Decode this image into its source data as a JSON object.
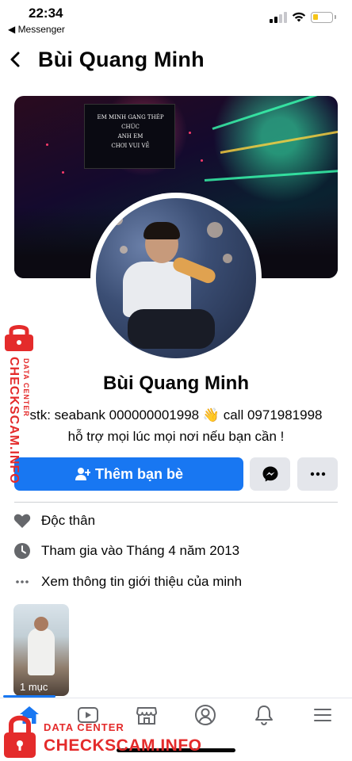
{
  "status_bar": {
    "time": "22:34",
    "back_app": "◀ Messenger",
    "battery_percent": 30,
    "battery_color": "#f5c518"
  },
  "header": {
    "title": "Bùi Quang Minh",
    "back_icon": "chevron-left-icon"
  },
  "cover": {
    "screen_text": "EM MINH GANG THÉP\nCHÚC\nANH EM\nCHƠI VUI VẺ"
  },
  "profile": {
    "name": "Bùi Quang Minh",
    "bio_line1": "stk: seabank 000000001998 👋 call 0971981998",
    "bio_line2": "hỗ trợ mọi lúc mọi nơi nếu bạn cần !"
  },
  "actions": {
    "add_friend_label": "Thêm bạn bè",
    "add_friend_icon": "person-add-icon",
    "message_icon": "messenger-icon",
    "more_icon": "more-icon",
    "accent": "#1877f2"
  },
  "info": {
    "relationship": "Độc thân",
    "joined": "Tham gia vào Tháng 4 năm 2013",
    "see_about": "Xem thông tin giới thiệu của minh"
  },
  "photos": {
    "caption": "1 mục"
  },
  "bottom_nav": [
    {
      "name": "home",
      "icon": "home-icon",
      "active": true
    },
    {
      "name": "video",
      "icon": "video-icon",
      "active": false
    },
    {
      "name": "marketplace",
      "icon": "marketplace-icon",
      "active": false
    },
    {
      "name": "profile",
      "icon": "profile-icon",
      "active": false
    },
    {
      "name": "notifications",
      "icon": "bell-icon",
      "active": false
    },
    {
      "name": "menu",
      "icon": "menu-icon",
      "active": false
    }
  ],
  "watermark": {
    "title": "CHECKSCAM.INFO",
    "subtitle": "DATA CENTER",
    "color": "#e42b2b"
  }
}
